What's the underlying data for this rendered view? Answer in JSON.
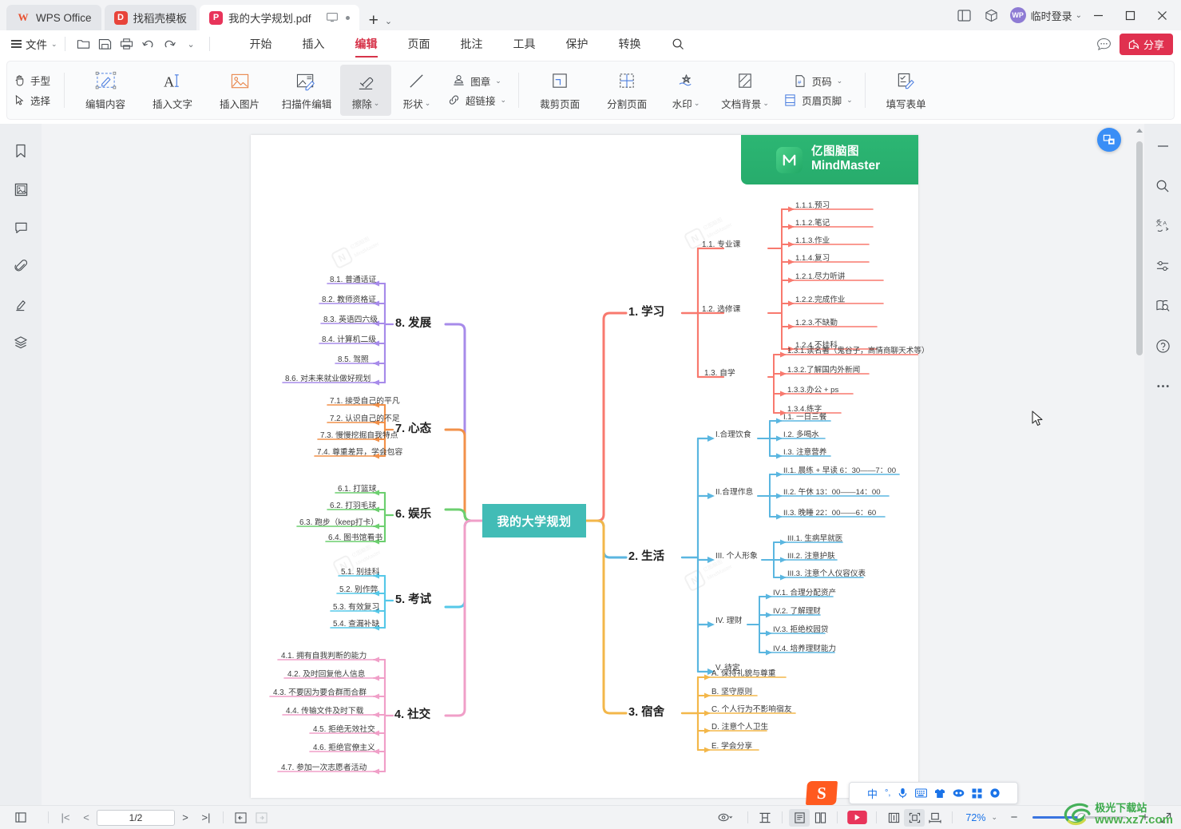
{
  "titlebar": {
    "tabs": [
      {
        "label": "WPS Office",
        "icon": "wps-logo-icon"
      },
      {
        "label": "找稻壳模板",
        "icon": "docer-icon"
      },
      {
        "label": "我的大学规划.pdf",
        "icon": "pdf-file-icon"
      }
    ],
    "new_tab": "+",
    "tab_dropdown": "⌄",
    "right_icons": [
      "sidebar-toggle-icon",
      "cube-icon"
    ],
    "account": {
      "avatar": "WP",
      "label": "临时登录",
      "caret": "⌄"
    },
    "window_controls": [
      "minimize",
      "maximize",
      "close"
    ]
  },
  "menubar": {
    "file_label": "文件",
    "file_caret": "⌄",
    "quick_access": [
      "new-folder-icon",
      "save-icon",
      "print-icon",
      "undo-icon",
      "redo-icon",
      "more-caret-icon"
    ],
    "menus": [
      {
        "label": "开始",
        "active": false
      },
      {
        "label": "插入",
        "active": false
      },
      {
        "label": "编辑",
        "active": true
      },
      {
        "label": "页面",
        "active": false
      },
      {
        "label": "批注",
        "active": false
      },
      {
        "label": "工具",
        "active": false
      },
      {
        "label": "保护",
        "active": false
      },
      {
        "label": "转换",
        "active": false
      }
    ],
    "search_icon": "search-icon",
    "feedback_icon": "feedback-icon",
    "share_label": "分享",
    "accent": "#e0314f"
  },
  "ribbon": {
    "hand_label": "手型",
    "select_label": "选择",
    "buttons": [
      {
        "label": "编辑内容",
        "icon": "edit-content-icon",
        "caret": false,
        "selected": false
      },
      {
        "label": "插入文字",
        "icon": "insert-text-icon",
        "caret": false,
        "selected": false
      },
      {
        "label": "插入图片",
        "icon": "insert-image-icon",
        "caret": false,
        "selected": false
      },
      {
        "label": "扫描件编辑",
        "icon": "scan-edit-icon",
        "caret": false,
        "selected": false
      },
      {
        "label": "擦除",
        "icon": "eraser-icon",
        "caret": true,
        "selected": true
      }
    ],
    "shape_label": "形状",
    "stamp_label": "图章",
    "hyperlink_label": "超链接",
    "page_buttons": [
      {
        "label": "裁剪页面",
        "icon": "crop-page-icon",
        "caret": false
      },
      {
        "label": "分割页面",
        "icon": "split-page-icon",
        "caret": false
      },
      {
        "label": "水印",
        "icon": "watermark-icon",
        "caret": true
      },
      {
        "label": "文档背景",
        "icon": "doc-background-icon",
        "caret": true
      }
    ],
    "page_number_label": "页码",
    "header_footer_label": "页眉页脚",
    "fill_form_label": "填写表单"
  },
  "left_rail": [
    "bookmark-icon",
    "thumbnail-icon",
    "comment-icon",
    "attachment-icon",
    "signature-icon",
    "layers-icon"
  ],
  "right_rail": [
    "minimize-panel-icon",
    "search-icon",
    "translate-icon",
    "settings-sliders-icon",
    "page-search-icon",
    "help-icon",
    "more-icon"
  ],
  "document": {
    "brand": {
      "cn": "亿图脑图",
      "en": "MindMaster",
      "icon": "mindmaster-logo-icon",
      "color": "#2cb673"
    },
    "watermark_text_cn": "亿图脑图",
    "watermark_text_en": "MindMaster"
  },
  "chart_data": {
    "type": "diagram",
    "title": "我的大学规划",
    "center": {
      "label": "我的大学规划",
      "color": "#42bcb6"
    },
    "branches": [
      {
        "id": "1",
        "label": "1. 学习",
        "color": "#f8796e",
        "side": "right",
        "children": [
          {
            "label": "1.1. 专业课",
            "children": [
              "1.1.1.预习",
              "1.1.2.笔记",
              "1.1.3.作业",
              "1.1.4.复习"
            ]
          },
          {
            "label": "1.2. 选修课",
            "children": [
              "1.2.1.尽力听讲",
              "1.2.2.完成作业",
              "1.2.3.不缺勤",
              "1.2.4.不挂科"
            ]
          },
          {
            "label": "1.3. 自学",
            "children": [
              "1.3.1.读名著（鬼谷子，高情商聊天术等）",
              "1.3.2.了解国内外新闻",
              "1.3.3.办公 + ps",
              "1.3.4.练字"
            ]
          }
        ]
      },
      {
        "id": "2",
        "label": "2. 生活",
        "color": "#5ab6e0",
        "side": "right",
        "children": [
          {
            "label": "I.合理饮食",
            "children": [
              "I.1. 一日三餐",
              "I.2. 多喝水",
              "I.3. 注意营养"
            ]
          },
          {
            "label": "II.合理作息",
            "children": [
              "II.1. 晨练 + 早读 6：30——7：00",
              "II.2. 午休  13：00——14：00",
              "II.3. 晚睡 22：00——6：60"
            ]
          },
          {
            "label": "III. 个人形象",
            "children": [
              "III.1. 生病早就医",
              "III.2. 注意护肤",
              "III.3. 注意个人仪容仪表"
            ]
          },
          {
            "label": "IV. 理财",
            "children": [
              "IV.1. 合理分配资产",
              "IV.2. 了解理财",
              "IV.3. 拒绝校园贷",
              "IV.4. 培养理财能力"
            ]
          },
          {
            "label": "V. 待定",
            "children": []
          }
        ]
      },
      {
        "id": "3",
        "label": "3. 宿舍",
        "color": "#f3b74a",
        "side": "right",
        "children": [
          {
            "label": "A. 保持礼貌与尊重",
            "children": []
          },
          {
            "label": "B. 坚守原则",
            "children": []
          },
          {
            "label": "C. 个人行为不影响宿友",
            "children": []
          },
          {
            "label": "D. 注意个人卫生",
            "children": []
          },
          {
            "label": "E. 学会分享",
            "children": []
          }
        ]
      },
      {
        "id": "4",
        "label": "4. 社交",
        "color": "#f09fc8",
        "side": "left",
        "children": [
          {
            "label": "4.1. 拥有自我判断的能力",
            "children": []
          },
          {
            "label": "4.2. 及时回复他人信息",
            "children": []
          },
          {
            "label": "4.3. 不要因为要合群而合群",
            "children": []
          },
          {
            "label": "4.4. 传输文件及时下载",
            "children": []
          },
          {
            "label": "4.5. 拒绝无效社交",
            "children": []
          },
          {
            "label": "4.6. 拒绝官僚主义",
            "children": []
          },
          {
            "label": "4.7. 参加一次志愿者活动",
            "children": []
          }
        ]
      },
      {
        "id": "5",
        "label": "5. 考试",
        "color": "#56c8e8",
        "side": "left",
        "children": [
          {
            "label": "5.1. 别挂科",
            "children": []
          },
          {
            "label": "5.2. 别作弊",
            "children": []
          },
          {
            "label": "5.3. 有效复习",
            "children": []
          },
          {
            "label": "5.4. 查漏补缺",
            "children": []
          }
        ]
      },
      {
        "id": "6",
        "label": "6. 娱乐",
        "color": "#6ccf6f",
        "side": "left",
        "children": [
          {
            "label": "6.1. 打篮球",
            "children": []
          },
          {
            "label": "6.2. 打羽毛球",
            "children": []
          },
          {
            "label": "6.3. 跑步（keep打卡）",
            "children": []
          },
          {
            "label": "6.4. 图书馆看书",
            "children": []
          }
        ]
      },
      {
        "id": "7",
        "label": "7. 心态",
        "color": "#f2914a",
        "side": "left",
        "children": [
          {
            "label": "7.1. 接受自己的平凡",
            "children": []
          },
          {
            "label": "7.2. 认识自己的不足",
            "children": []
          },
          {
            "label": "7.3. 慢慢挖掘自我特点",
            "children": []
          },
          {
            "label": "7.4. 尊重差异，学会包容",
            "children": []
          }
        ]
      },
      {
        "id": "8",
        "label": "8. 发展",
        "color": "#a78bea",
        "side": "left",
        "children": [
          {
            "label": "8.1. 普通话证",
            "children": []
          },
          {
            "label": "8.2. 教师资格证",
            "children": []
          },
          {
            "label": "8.3. 英语四六级",
            "children": []
          },
          {
            "label": "8.4. 计算机二级",
            "children": []
          },
          {
            "label": "8.5. 驾照",
            "children": []
          },
          {
            "label": "8.6. 对未来就业做好规划",
            "children": []
          }
        ]
      }
    ]
  },
  "ime": {
    "logo": "sogou-icon",
    "items": [
      "中",
      "°,",
      "microphone-icon",
      "keyboard-icon",
      "skin-icon",
      "emoji-icon",
      "apps-icon",
      "settings-icon"
    ]
  },
  "status": {
    "left_icons": [
      "page-layout-icon"
    ],
    "first_page": "|<",
    "prev_page": "<",
    "page_indicator": "1/2",
    "next_page": ">",
    "last_page": ">|",
    "back_icon": "←",
    "forward_icon": "→",
    "eye_icon": "eye-icon",
    "tools": [
      "fit-height-icon",
      "single-page-icon",
      "two-page-icon",
      "play-icon",
      "reading-icon",
      "fit-page-icon",
      "fit-width-icon"
    ],
    "zoom_level": "72%",
    "zoom_out": "−",
    "zoom_in": "+",
    "fullscreen_icon": "fullscreen-icon"
  },
  "watermark_site": {
    "cn": "极光下载站",
    "url": "www.xz7.com"
  }
}
